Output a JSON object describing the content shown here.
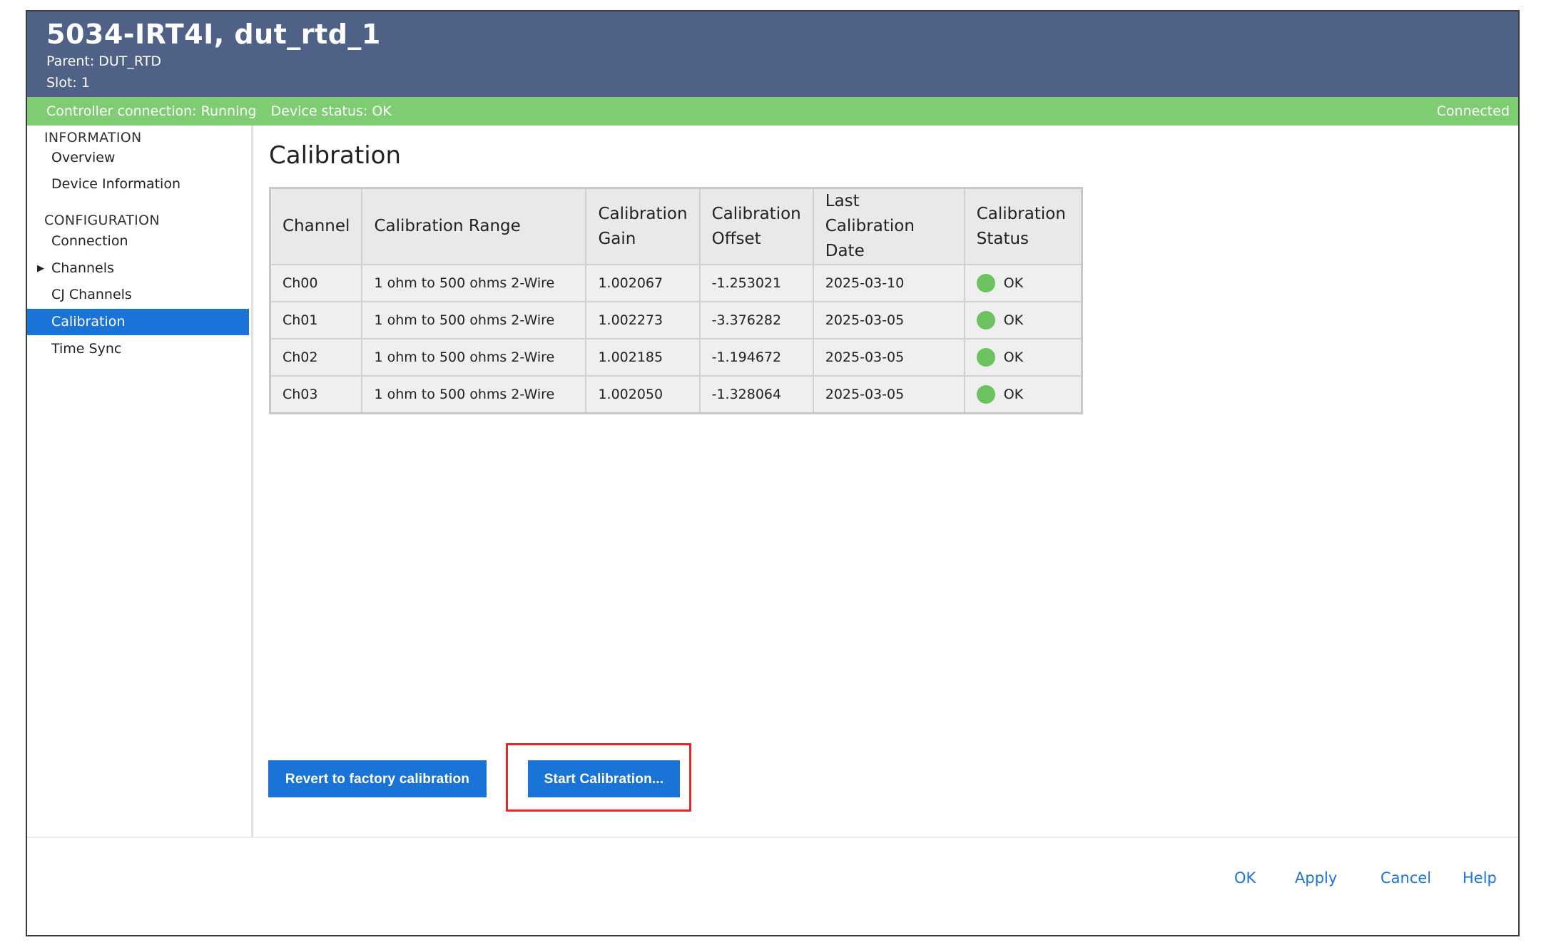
{
  "header": {
    "title": "5034-IRT4I, dut_rtd_1",
    "parent": "Parent: DUT_RTD",
    "slot": "Slot: 1"
  },
  "status": {
    "controller": "Controller connection: Running",
    "device": "Device status: OK",
    "connection": "Connected"
  },
  "sidebar": {
    "sections": [
      "INFORMATION",
      "CONFIGURATION"
    ],
    "items": [
      {
        "label": "Overview"
      },
      {
        "label": "Device Information"
      },
      {
        "label": "Connection"
      },
      {
        "label": "Channels"
      },
      {
        "label": "CJ Channels"
      },
      {
        "label": "Calibration",
        "active": true
      },
      {
        "label": "Time Sync"
      }
    ]
  },
  "main": {
    "title": "Calibration",
    "table": {
      "headers": [
        "Channel",
        "Calibration Range",
        "Calibration Gain",
        "Calibration Offset",
        "Last Calibration Date",
        "Calibration Status"
      ],
      "rows": [
        [
          "Ch00",
          "1 ohm to 500 ohms 2-Wire",
          "1.002067",
          "-1.253021",
          "2025-03-10",
          "OK"
        ],
        [
          "Ch01",
          "1 ohm to 500 ohms 2-Wire",
          "1.002273",
          "-3.376282",
          "2025-03-05",
          "OK"
        ],
        [
          "Ch02",
          "1 ohm to 500 ohms 2-Wire",
          "1.002185",
          "-1.194672",
          "2025-03-05",
          "OK"
        ],
        [
          "Ch03",
          "1 ohm to 500 ohms 2-Wire",
          "1.002050",
          "-1.328064",
          "2025-03-05",
          "OK"
        ]
      ]
    },
    "buttons": {
      "revert": "Revert to factory calibration",
      "start": "Start Calibration..."
    }
  },
  "footer": {
    "ok": "OK",
    "apply": "Apply",
    "cancel": "Cancel",
    "help": "Help"
  },
  "colors": {
    "header": "#4f6186",
    "status_bar": "#7ecd72",
    "accent": "#1a73d6",
    "status_ok": "#6cc25f",
    "highlight": "#e02a2a"
  }
}
